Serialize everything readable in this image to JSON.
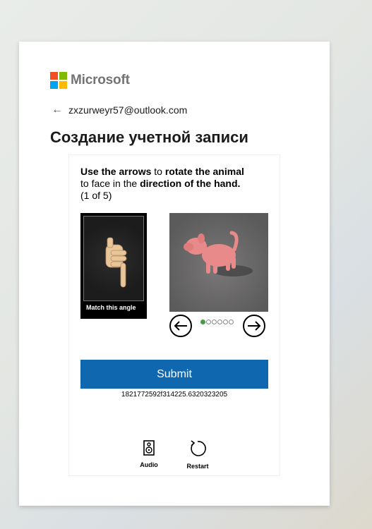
{
  "brand": {
    "name": "Microsoft",
    "colors": [
      "#f25022",
      "#7fba00",
      "#00a4ef",
      "#ffb900"
    ]
  },
  "account": {
    "email": "zxzurweyr57@outlook.com",
    "back_icon": "back-arrow-icon"
  },
  "page": {
    "title": "Создание учетной записи"
  },
  "challenge": {
    "instruction": {
      "part1": "Use the arrows",
      "part2": " to ",
      "part3": "rotate the animal",
      "part4": " to face in the ",
      "part5": "direction of the hand.",
      "progress": "(1 of 5)"
    },
    "reference_caption": "Match this angle",
    "carousel": {
      "current": 1,
      "total": 6
    },
    "submit_label": "Submit",
    "session_id": "1821772592f314225.6320323205",
    "tools": {
      "audio_label": "Audio",
      "restart_label": "Restart"
    },
    "accent_color": "#0f67b0"
  }
}
